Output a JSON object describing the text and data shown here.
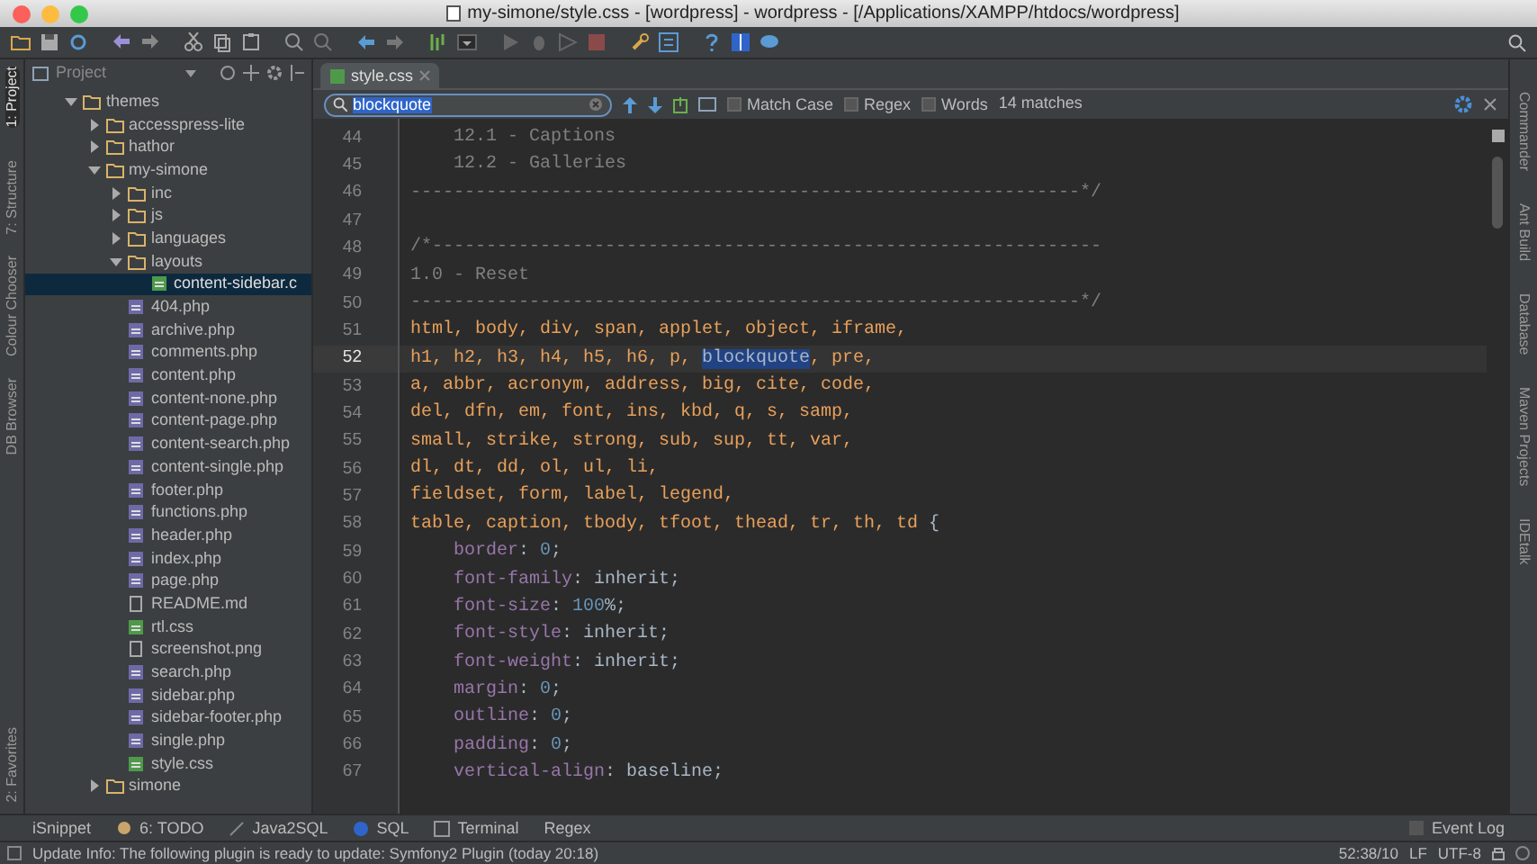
{
  "window": {
    "title": "my-simone/style.css - [wordpress] - wordpress - [/Applications/XAMPP/htdocs/wordpress]"
  },
  "left_tool_tabs": [
    {
      "label": "1: Project",
      "selected": true
    },
    {
      "label": "7: Structure",
      "selected": false
    },
    {
      "label": "Colour Chooser",
      "selected": false
    },
    {
      "label": "DB Browser",
      "selected": false
    },
    {
      "label": "2: Favorites",
      "selected": false
    }
  ],
  "right_tool_tabs": [
    "Commander",
    "Ant Build",
    "Database",
    "Maven Projects",
    "IDEtalk"
  ],
  "project_panel": {
    "title": "Project",
    "tree": [
      {
        "label": "themes",
        "kind": "folder",
        "expanded": true,
        "selected": false,
        "children": [
          {
            "label": "accesspress-lite",
            "kind": "folder",
            "expanded": false,
            "selected": false
          },
          {
            "label": "hathor",
            "kind": "folder",
            "expanded": false,
            "selected": false
          },
          {
            "label": "my-simone",
            "kind": "folder",
            "expanded": true,
            "selected": false,
            "children": [
              {
                "label": "inc",
                "kind": "folder",
                "expanded": false,
                "selected": false
              },
              {
                "label": "js",
                "kind": "folder",
                "expanded": false,
                "selected": false
              },
              {
                "label": "languages",
                "kind": "folder",
                "expanded": false,
                "selected": false
              },
              {
                "label": "layouts",
                "kind": "folder",
                "expanded": true,
                "selected": false,
                "children": [
                  {
                    "label": "content-sidebar.c",
                    "kind": "css",
                    "selected": true
                  }
                ]
              },
              {
                "label": "404.php",
                "kind": "php",
                "selected": false
              },
              {
                "label": "archive.php",
                "kind": "php",
                "selected": false
              },
              {
                "label": "comments.php",
                "kind": "php",
                "selected": false
              },
              {
                "label": "content.php",
                "kind": "php",
                "selected": false
              },
              {
                "label": "content-none.php",
                "kind": "php",
                "selected": false
              },
              {
                "label": "content-page.php",
                "kind": "php",
                "selected": false
              },
              {
                "label": "content-search.php",
                "kind": "php",
                "selected": false
              },
              {
                "label": "content-single.php",
                "kind": "php",
                "selected": false
              },
              {
                "label": "footer.php",
                "kind": "php",
                "selected": false
              },
              {
                "label": "functions.php",
                "kind": "php",
                "selected": false
              },
              {
                "label": "header.php",
                "kind": "php",
                "selected": false
              },
              {
                "label": "index.php",
                "kind": "php",
                "selected": false
              },
              {
                "label": "page.php",
                "kind": "php",
                "selected": false
              },
              {
                "label": "README.md",
                "kind": "text",
                "selected": false
              },
              {
                "label": "rtl.css",
                "kind": "css",
                "selected": false
              },
              {
                "label": "screenshot.png",
                "kind": "text",
                "selected": false
              },
              {
                "label": "search.php",
                "kind": "php",
                "selected": false
              },
              {
                "label": "sidebar.php",
                "kind": "php",
                "selected": false
              },
              {
                "label": "sidebar-footer.php",
                "kind": "php",
                "selected": false
              },
              {
                "label": "single.php",
                "kind": "php",
                "selected": false
              },
              {
                "label": "style.css",
                "kind": "css",
                "selected": false
              }
            ]
          },
          {
            "label": "simone",
            "kind": "folder",
            "expanded": false,
            "selected": false
          }
        ]
      }
    ]
  },
  "editor_tabs": [
    {
      "label": "style.css",
      "selected": true
    }
  ],
  "find_bar": {
    "value": "blockquote",
    "options": [
      {
        "label": "Match Case",
        "checked": false
      },
      {
        "label": "Regex",
        "checked": false
      },
      {
        "label": "Words",
        "checked": false
      }
    ],
    "result": "14 matches"
  },
  "code_lines": [
    {
      "number": "44",
      "current": false,
      "tokens": [
        {
          "kind": "comment",
          "text": "    12.1 - Captions"
        }
      ]
    },
    {
      "number": "45",
      "current": false,
      "tokens": [
        {
          "kind": "comment",
          "text": "    12.2 - Galleries"
        }
      ]
    },
    {
      "number": "46",
      "current": false,
      "tokens": [
        {
          "kind": "comment",
          "text": "--------------------------------------------------------------*/"
        }
      ]
    },
    {
      "number": "47",
      "current": false
    },
    {
      "number": "48",
      "current": false,
      "tokens": [
        {
          "kind": "comment",
          "text": "/*--------------------------------------------------------------"
        }
      ]
    },
    {
      "number": "49",
      "current": false,
      "tokens": [
        {
          "kind": "comment",
          "text": "1.0 - Reset"
        }
      ]
    },
    {
      "number": "50",
      "current": false,
      "tokens": [
        {
          "kind": "comment",
          "text": "--------------------------------------------------------------*/"
        }
      ]
    },
    {
      "number": "51",
      "current": false,
      "tokens": [
        {
          "kind": "selector",
          "text": "html, body, div, span, applet, object, iframe,"
        }
      ]
    },
    {
      "number": "52",
      "current": true,
      "tokens": [
        {
          "kind": "selector",
          "text": "h1, h2, h3, h4, h5, h6, p, "
        },
        {
          "kind": "match",
          "text": "blockquote"
        },
        {
          "kind": "selector",
          "text": ", pre,"
        }
      ]
    },
    {
      "number": "53",
      "current": false,
      "tokens": [
        {
          "kind": "selector",
          "text": "a, abbr, acronym, address, big, cite, code,"
        }
      ]
    },
    {
      "number": "54",
      "current": false,
      "tokens": [
        {
          "kind": "selector",
          "text": "del, dfn, em, font, ins, kbd, q, s, samp,"
        }
      ]
    },
    {
      "number": "55",
      "current": false,
      "tokens": [
        {
          "kind": "selector",
          "text": "small, strike, strong, sub, sup, tt, var,"
        }
      ]
    },
    {
      "number": "56",
      "current": false,
      "tokens": [
        {
          "kind": "selector",
          "text": "dl, dt, dd, ol, ul, li,"
        }
      ]
    },
    {
      "number": "57",
      "current": false,
      "tokens": [
        {
          "kind": "selector",
          "text": "fieldset, form, label, legend,"
        }
      ]
    },
    {
      "number": "58",
      "current": false,
      "tokens": [
        {
          "kind": "selector",
          "text": "table, caption, tbody, tfoot, thead, tr, th, td "
        },
        {
          "kind": "plain",
          "text": "{"
        }
      ]
    },
    {
      "number": "59",
      "current": false,
      "tokens": [
        {
          "kind": "property",
          "text": "    border"
        },
        {
          "kind": "plain",
          "text": ": "
        },
        {
          "kind": "number",
          "text": "0"
        },
        {
          "kind": "plain",
          "text": ";"
        }
      ]
    },
    {
      "number": "60",
      "current": false,
      "tokens": [
        {
          "kind": "property",
          "text": "    font-family"
        },
        {
          "kind": "plain",
          "text": ": inherit;"
        }
      ]
    },
    {
      "number": "61",
      "current": false,
      "tokens": [
        {
          "kind": "property",
          "text": "    font-size"
        },
        {
          "kind": "plain",
          "text": ": "
        },
        {
          "kind": "number",
          "text": "100"
        },
        {
          "kind": "plain",
          "text": "%;"
        }
      ]
    },
    {
      "number": "62",
      "current": false,
      "tokens": [
        {
          "kind": "property",
          "text": "    font-style"
        },
        {
          "kind": "plain",
          "text": ": inherit;"
        }
      ]
    },
    {
      "number": "63",
      "current": false,
      "tokens": [
        {
          "kind": "property",
          "text": "    font-weight"
        },
        {
          "kind": "plain",
          "text": ": inherit;"
        }
      ]
    },
    {
      "number": "64",
      "current": false,
      "tokens": [
        {
          "kind": "property",
          "text": "    margin"
        },
        {
          "kind": "plain",
          "text": ": "
        },
        {
          "kind": "number",
          "text": "0"
        },
        {
          "kind": "plain",
          "text": ";"
        }
      ]
    },
    {
      "number": "65",
      "current": false,
      "tokens": [
        {
          "kind": "property",
          "text": "    outline"
        },
        {
          "kind": "plain",
          "text": ": "
        },
        {
          "kind": "number",
          "text": "0"
        },
        {
          "kind": "plain",
          "text": ";"
        }
      ]
    },
    {
      "number": "66",
      "current": false,
      "tokens": [
        {
          "kind": "property",
          "text": "    padding"
        },
        {
          "kind": "plain",
          "text": ": "
        },
        {
          "kind": "number",
          "text": "0"
        },
        {
          "kind": "plain",
          "text": ";"
        }
      ]
    },
    {
      "number": "67",
      "current": false,
      "tokens": [
        {
          "kind": "property",
          "text": "    vertical-align"
        },
        {
          "kind": "plain",
          "text": ": baseline;"
        }
      ]
    }
  ],
  "bottom_tool_tabs": [
    "iSnippet",
    "6: TODO",
    "Java2SQL",
    "SQL",
    "Terminal",
    "Regex"
  ],
  "event_log": "Event Log",
  "status_bar": {
    "message": "Update Info: The following plugin is ready to update: Symfony2 Plugin (today 20:18)",
    "position": "52:38/10",
    "line_separator": "LF",
    "encoding": "UTF-8"
  }
}
